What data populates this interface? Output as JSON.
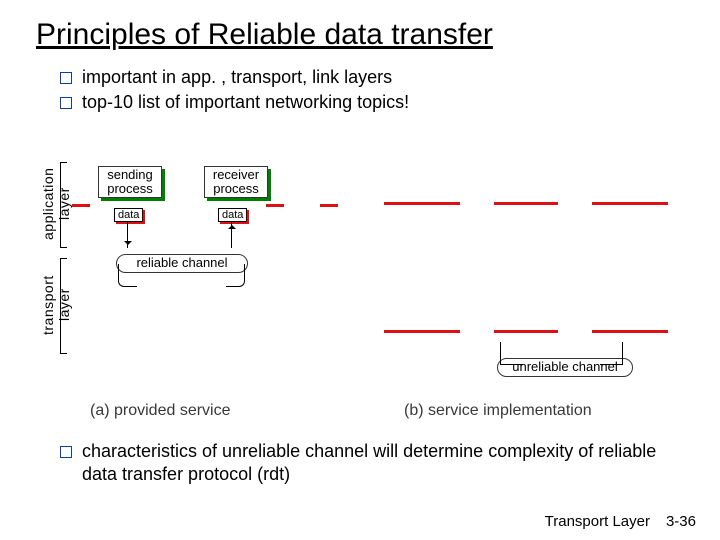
{
  "title": "Principles of Reliable data transfer",
  "top_bullets": [
    "important in app. , transport, link layers",
    "top-10 list of important networking topics!"
  ],
  "bottom_bullet": "characteristics of unreliable channel will determine complexity of reliable data transfer protocol (rdt)",
  "diagram": {
    "layer_labels": {
      "application": "application\nlayer",
      "transport": "transport\nlayer"
    },
    "boxes": {
      "sending": "sending\nprocess",
      "receiver": "receiver\nprocess",
      "data": "data",
      "reliable_channel": "reliable channel",
      "unreliable_channel": "unreliable channel"
    },
    "captions": {
      "a": "(a) provided service",
      "b": "(b) service implementation"
    }
  },
  "footer": {
    "chapter": "Transport Layer",
    "page": "3-36"
  }
}
